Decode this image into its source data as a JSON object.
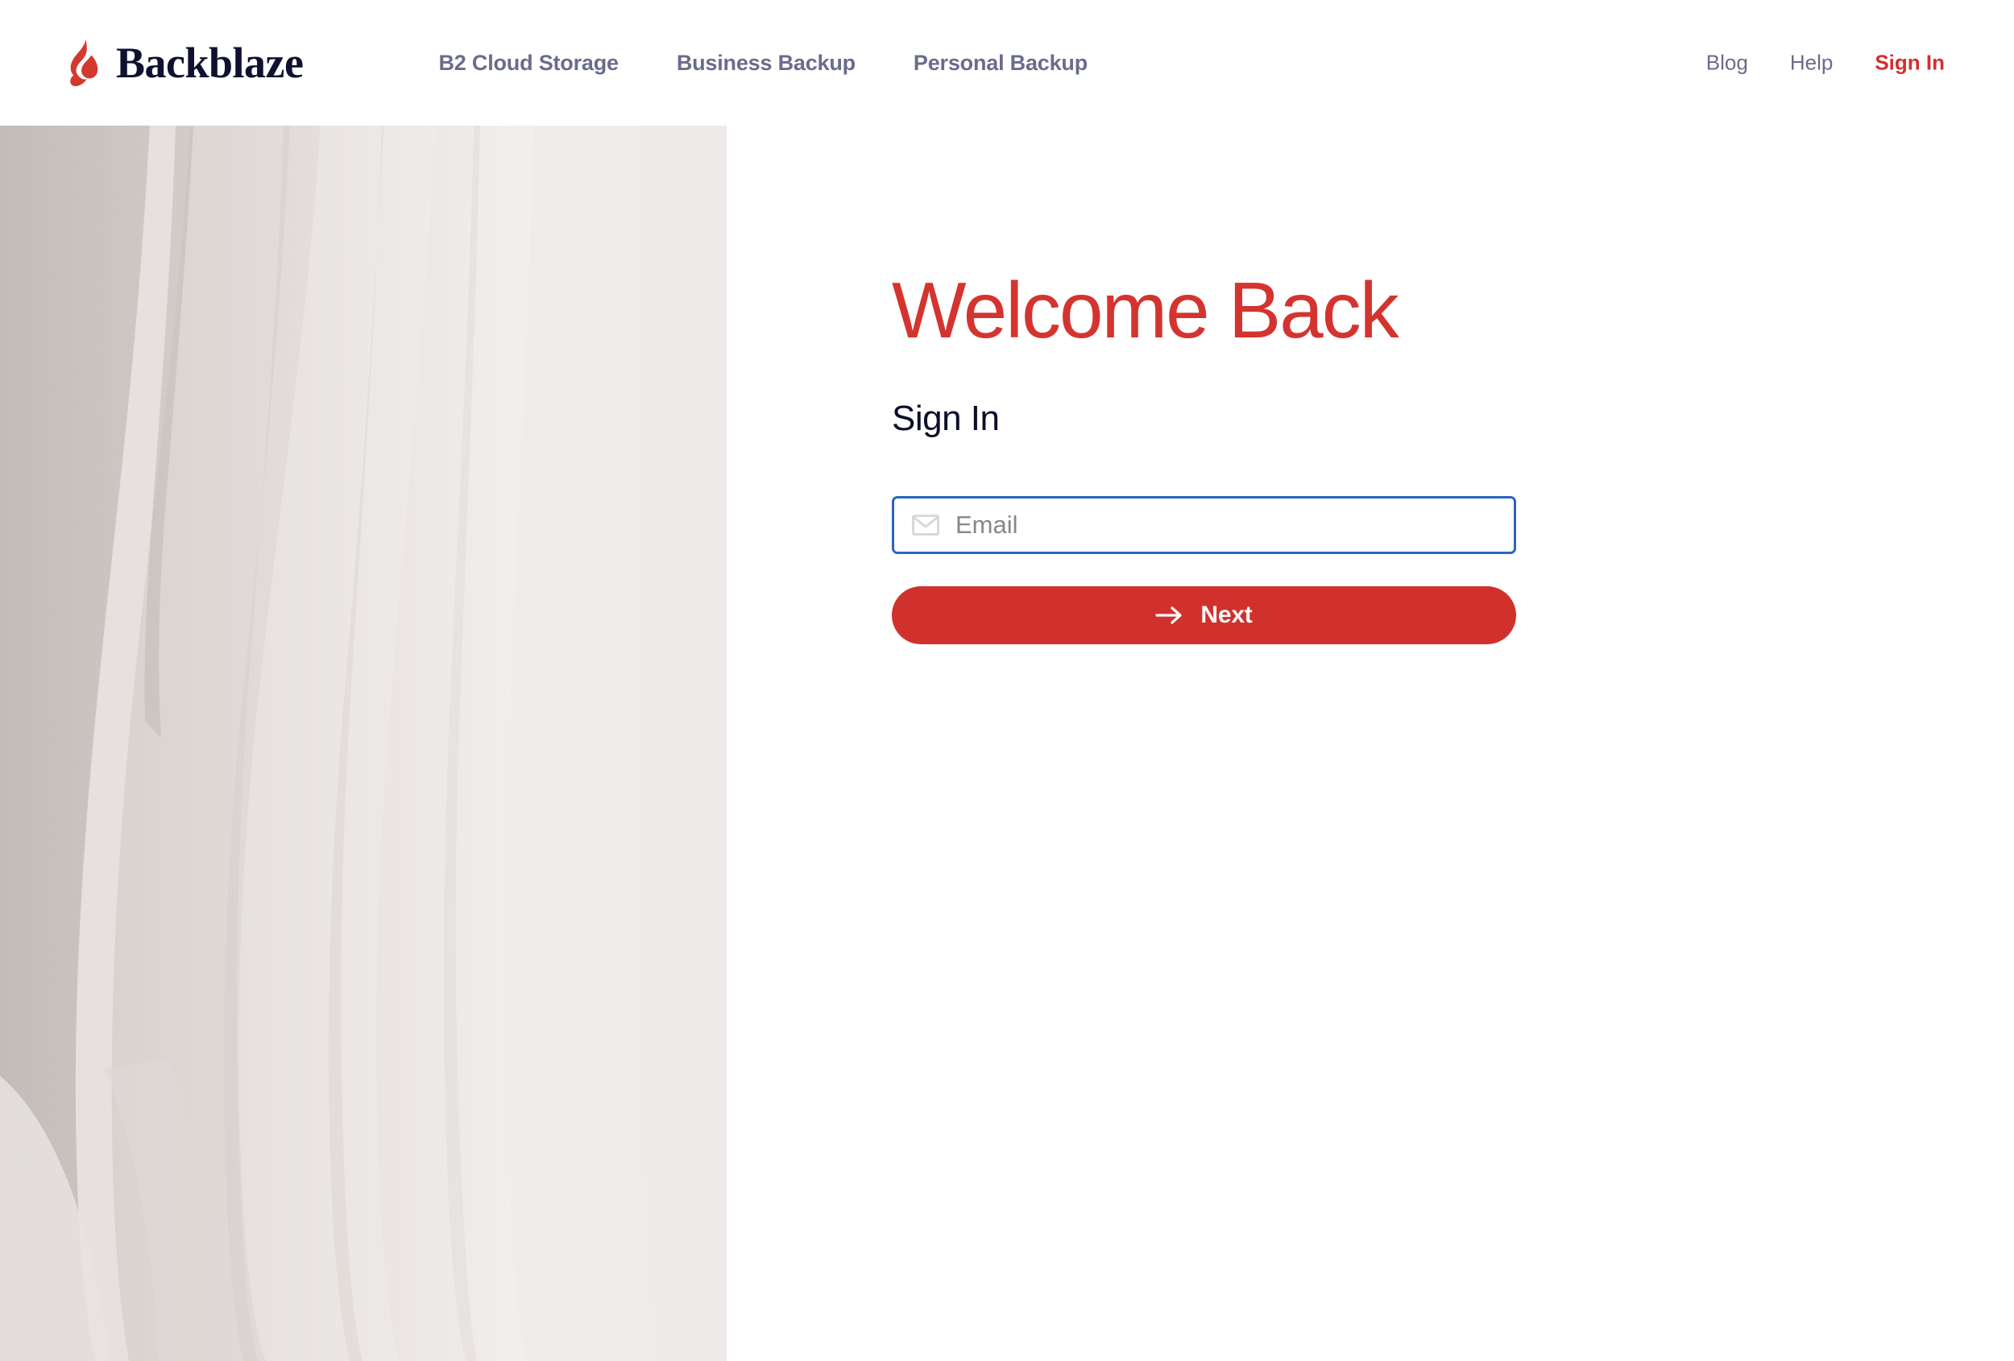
{
  "header": {
    "brand": {
      "name": "Backblaze",
      "logo_icon": "flame-icon"
    },
    "primary_nav": [
      {
        "label": "B2 Cloud Storage"
      },
      {
        "label": "Business Backup"
      },
      {
        "label": "Personal Backup"
      }
    ],
    "utility_nav": [
      {
        "label": "Blog",
        "active": false
      },
      {
        "label": "Help",
        "active": false
      },
      {
        "label": "Sign In",
        "active": true
      }
    ]
  },
  "main": {
    "title": "Welcome Back",
    "subtitle": "Sign In",
    "email_field": {
      "icon": "envelope-icon",
      "value": "",
      "placeholder": "Email"
    },
    "next_button": {
      "label": "Next",
      "icon": "arrow-right-icon"
    }
  },
  "colors": {
    "brand_red": "#d32f2f",
    "title_red": "#d4342f",
    "button_red": "#d0312d",
    "nav_gray": "#6a6c8c",
    "navy": "#0d0d2b",
    "focus_blue": "#2a64c4",
    "panel_beige": "#efebea"
  }
}
